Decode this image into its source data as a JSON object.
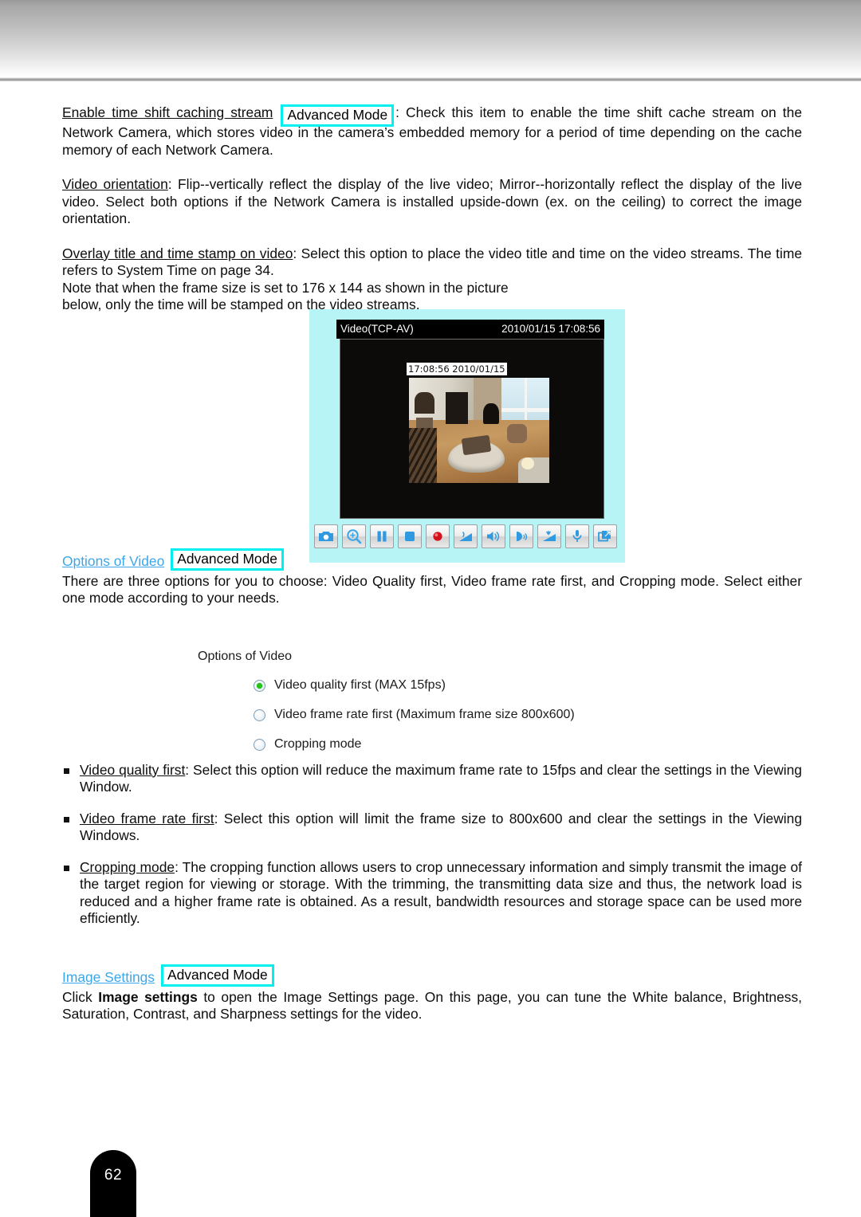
{
  "page": {
    "number": "62",
    "badge_label": "Advanced Mode"
  },
  "sections": {
    "time_shift": {
      "term": "Enable time shift caching stream",
      "text_after_badge": ": Check this item to enable the time shift cache stream on the Network Camera, which stores video in the camera’s embedded memory for a period of time depending on the cache memory of each Network Camera."
    },
    "video_orientation": {
      "term": "Video orientation",
      "body": ": Flip--vertically reflect the display of the live video; Mirror--horizontally reflect the display of the live video. Select both options if the Network Camera is installed upside-down (ex. on the ceiling) to correct the image orientation."
    },
    "overlay_title": {
      "term": "Overlay title and time stamp on video",
      "body": ": Select this option to place the video title and time on the video streams. The time refers to System Time on page 34.",
      "note": "Note that when the frame size is set to 176 x 144 as shown in the picture below, only the time will be stamped on the video streams."
    },
    "options_of_video": {
      "heading": "Options of Video",
      "body": "There are three options for you to choose: Video Quality first, Video frame rate first, and Cropping mode. Select either one mode according to your needs."
    },
    "image_settings": {
      "heading": "Image Settings",
      "body_pre": "Click ",
      "body_bold": "Image settings",
      "body_post": " to open the Image Settings page. On this page, you can tune the White balance, Brightness, Saturation, Contrast, and Sharpness settings for the video."
    }
  },
  "video_player": {
    "title": "Video(TCP-AV)",
    "timestamp": "2010/01/15 17:08:56",
    "overlay_timestamp": "17:08:56 2010/01/15",
    "panel_color": "#b6f4f6",
    "toolbar": [
      {
        "name": "snapshot-icon",
        "label": "Snapshot"
      },
      {
        "name": "digital-zoom-icon",
        "label": "Digital Zoom"
      },
      {
        "name": "pause-icon",
        "label": "Pause"
      },
      {
        "name": "stop-icon",
        "label": "Stop"
      },
      {
        "name": "record-icon",
        "label": "Start MP4 Recording"
      },
      {
        "name": "volume-mute-icon",
        "label": "Volume Mute"
      },
      {
        "name": "volume-icon",
        "label": "Volume"
      },
      {
        "name": "talk-icon",
        "label": "Talk"
      },
      {
        "name": "mic-volume-icon",
        "label": "Mic Volume"
      },
      {
        "name": "microphone-icon",
        "label": "Microphone Mute"
      },
      {
        "name": "fullscreen-icon",
        "label": "Full Screen"
      }
    ]
  },
  "options_figure": {
    "title": "Options of Video",
    "radios": [
      {
        "label": "Video quality first (MAX 15fps)",
        "checked": true
      },
      {
        "label": "Video frame rate first (Maximum frame size 800x600)",
        "checked": false
      },
      {
        "label": "Cropping mode",
        "checked": false
      }
    ],
    "selected_color": "#22c416"
  },
  "bullets": [
    {
      "term": "Video quality first",
      "body": ": Select this option will reduce the maximum frame rate to 15fps and clear the settings in the Viewing Window."
    },
    {
      "term": "Video frame rate first",
      "body": ": Select this option will limit the frame size to 800x600 and clear the settings in the Viewing Windows."
    },
    {
      "term": "Cropping mode",
      "body": ": The cropping function allows users to crop unnecessary information and simply transmit the image of the target region for viewing or storage. With the trimming, the transmitting data size and thus, the network load is reduced and a higher frame rate is obtained. As a result, bandwidth resources and storage space can be used more efficiently."
    }
  ]
}
